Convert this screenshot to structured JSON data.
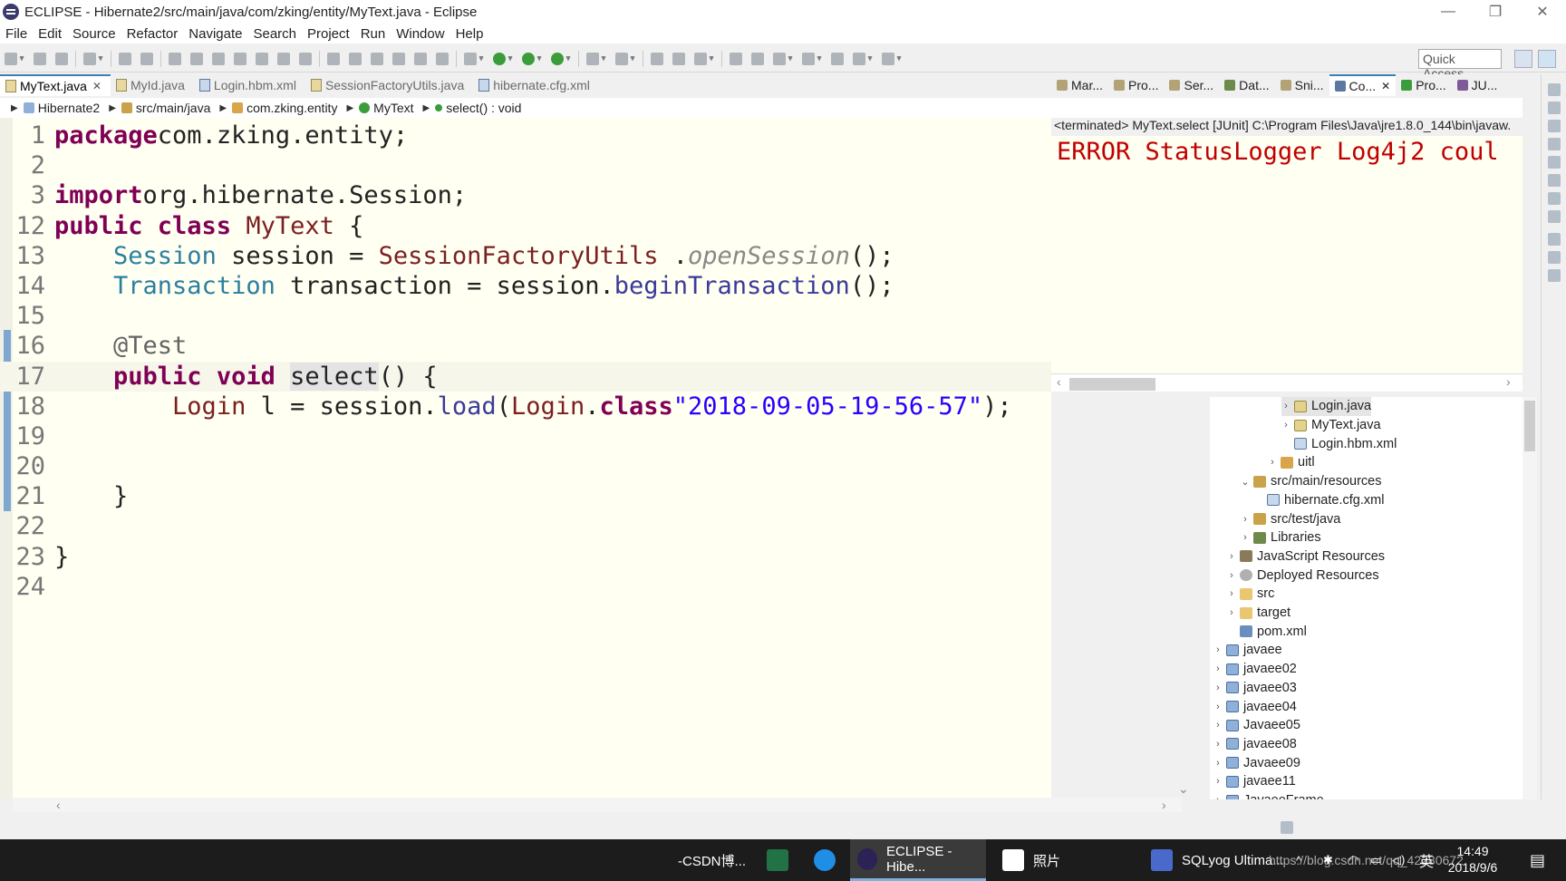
{
  "window": {
    "title": "ECLIPSE - Hibernate2/src/main/java/com/zking/entity/MyText.java - Eclipse",
    "minimize": "—",
    "restore": "❐",
    "close": "✕"
  },
  "menu": [
    "File",
    "Edit",
    "Source",
    "Refactor",
    "Navigate",
    "Search",
    "Project",
    "Run",
    "Window",
    "Help"
  ],
  "toolbar": {
    "quick_access_placeholder": "Quick Access"
  },
  "editor": {
    "tabs": [
      {
        "label": "MyText.java",
        "active": true,
        "close": "✕"
      },
      {
        "label": "MyId.java"
      },
      {
        "label": "Login.hbm.xml"
      },
      {
        "label": "SessionFactoryUtils.java"
      },
      {
        "label": "hibernate.cfg.xml"
      }
    ],
    "breadcrumb": [
      "Hibernate2",
      "src/main/java",
      "com.zking.entity",
      "MyText",
      "select() : void"
    ],
    "lines": [
      {
        "n": "1",
        "tokens": [
          [
            "kw",
            "package"
          ],
          [
            "",
            "com.zking.entity;"
          ]
        ]
      },
      {
        "n": "2",
        "tokens": []
      },
      {
        "n": "3",
        "tokens": [
          [
            "kw",
            "import"
          ],
          [
            "",
            "org.hibernate.Session;"
          ]
        ]
      },
      {
        "n": "12",
        "tokens": [
          [
            "kw",
            "public class "
          ],
          [
            "cls",
            "MyText"
          ],
          [
            "",
            " {"
          ]
        ]
      },
      {
        "n": "13",
        "tokens": [
          [
            "",
            "    "
          ],
          [
            "ty",
            "Session"
          ],
          [
            "",
            " session = "
          ],
          [
            "cls",
            "SessionFactoryUtils"
          ],
          [
            "",
            " ."
          ],
          [
            "ital",
            "openSession"
          ],
          [
            "",
            "();"
          ]
        ]
      },
      {
        "n": "14",
        "tokens": [
          [
            "",
            "    "
          ],
          [
            "ty",
            "Transaction"
          ],
          [
            "",
            " transaction = session."
          ],
          [
            "mth",
            "beginTransaction"
          ],
          [
            "",
            "();"
          ]
        ]
      },
      {
        "n": "15",
        "tokens": []
      },
      {
        "n": "16",
        "tokens": [
          [
            "",
            "    "
          ],
          [
            "ann",
            "@Test"
          ]
        ]
      },
      {
        "n": "17",
        "tokens": [
          [
            "",
            "    "
          ],
          [
            "kw",
            "public void "
          ],
          [
            "hl",
            "select"
          ],
          [
            "",
            "() {"
          ]
        ]
      },
      {
        "n": "18",
        "tokens": [
          [
            "",
            "        "
          ],
          [
            "cls",
            "Login"
          ],
          [
            "",
            " l = session."
          ],
          [
            "mth",
            "load"
          ],
          [
            "",
            "("
          ],
          [
            "cls",
            "Login"
          ],
          [
            "",
            "."
          ],
          [
            "kw",
            "class"
          ],
          [
            ", "
          ],
          [
            "str",
            "\"2018-09-05-19-56-57\""
          ],
          [
            "",
            ");"
          ]
        ]
      },
      {
        "n": "19",
        "tokens": []
      },
      {
        "n": "20",
        "tokens": []
      },
      {
        "n": "21",
        "tokens": [
          [
            "",
            "    }"
          ]
        ]
      },
      {
        "n": "22",
        "tokens": []
      },
      {
        "n": "23",
        "tokens": [
          [
            "",
            "}"
          ]
        ]
      },
      {
        "n": "24",
        "tokens": []
      }
    ]
  },
  "panel": {
    "tabs": [
      "Mar...",
      "Pro...",
      "Ser...",
      "Dat...",
      "Sni...",
      "Co...",
      "Pro...",
      "JU..."
    ],
    "active_tab": "Co...",
    "console_status": "<terminated> MyText.select [JUnit] C:\\Program Files\\Java\\jre1.8.0_144\\bin\\javaw.",
    "console_output": "ERROR StatusLogger Log4j2 coul"
  },
  "tree": [
    {
      "label": "Login.java",
      "indent": 5,
      "icon": "java",
      "twisty": "›",
      "selected": true
    },
    {
      "label": "MyText.java",
      "indent": 5,
      "icon": "java",
      "twisty": "›"
    },
    {
      "label": "Login.hbm.xml",
      "indent": 5,
      "icon": "xml",
      "twisty": ""
    },
    {
      "label": "uitl",
      "indent": 4,
      "icon": "pkg",
      "twisty": "›"
    },
    {
      "label": "src/main/resources",
      "indent": 2,
      "icon": "src",
      "twisty": "⌄"
    },
    {
      "label": "hibernate.cfg.xml",
      "indent": 3,
      "icon": "xml",
      "twisty": ""
    },
    {
      "label": "src/test/java",
      "indent": 2,
      "icon": "src",
      "twisty": "›"
    },
    {
      "label": "Libraries",
      "indent": 2,
      "icon": "lib",
      "twisty": "›"
    },
    {
      "label": "JavaScript Resources",
      "indent": 1,
      "icon": "js",
      "twisty": "›"
    },
    {
      "label": "Deployed Resources",
      "indent": 1,
      "icon": "dep",
      "twisty": "›"
    },
    {
      "label": "src",
      "indent": 1,
      "icon": "fold",
      "twisty": "›"
    },
    {
      "label": "target",
      "indent": 1,
      "icon": "fold",
      "twisty": "›"
    },
    {
      "label": "pom.xml",
      "indent": 1,
      "icon": "pom",
      "twisty": ""
    },
    {
      "label": "javaee",
      "indent": 0,
      "icon": "proj",
      "twisty": "›"
    },
    {
      "label": "javaee02",
      "indent": 0,
      "icon": "proj",
      "twisty": "›"
    },
    {
      "label": "javaee03",
      "indent": 0,
      "icon": "proj",
      "twisty": "›"
    },
    {
      "label": "javaee04",
      "indent": 0,
      "icon": "proj",
      "twisty": "›"
    },
    {
      "label": "Javaee05",
      "indent": 0,
      "icon": "proj",
      "twisty": "›"
    },
    {
      "label": "javaee08",
      "indent": 0,
      "icon": "proj",
      "twisty": "›"
    },
    {
      "label": "Javaee09",
      "indent": 0,
      "icon": "proj",
      "twisty": "›"
    },
    {
      "label": "javaee11",
      "indent": 0,
      "icon": "proj",
      "twisty": "›"
    },
    {
      "label": "JavaeeFrame",
      "indent": 0,
      "icon": "proj",
      "twisty": "›"
    }
  ],
  "taskbar": {
    "items": [
      {
        "label": "-CSDN博...",
        "icon": ""
      },
      {
        "label": "",
        "icon": "excel-icon"
      },
      {
        "label": "",
        "icon": "k-icon"
      },
      {
        "label": "ECLIPSE - Hibe...",
        "icon": "eclipse-icon"
      },
      {
        "label": "照片",
        "icon": "photos-icon"
      },
      {
        "label": "SQLyog Ultima...",
        "icon": "sqlyog-icon"
      }
    ],
    "ime": "英",
    "time": "14:49",
    "date": "2018/9/6",
    "watermark": "https://blog.csdn.net/qq_42280672"
  }
}
